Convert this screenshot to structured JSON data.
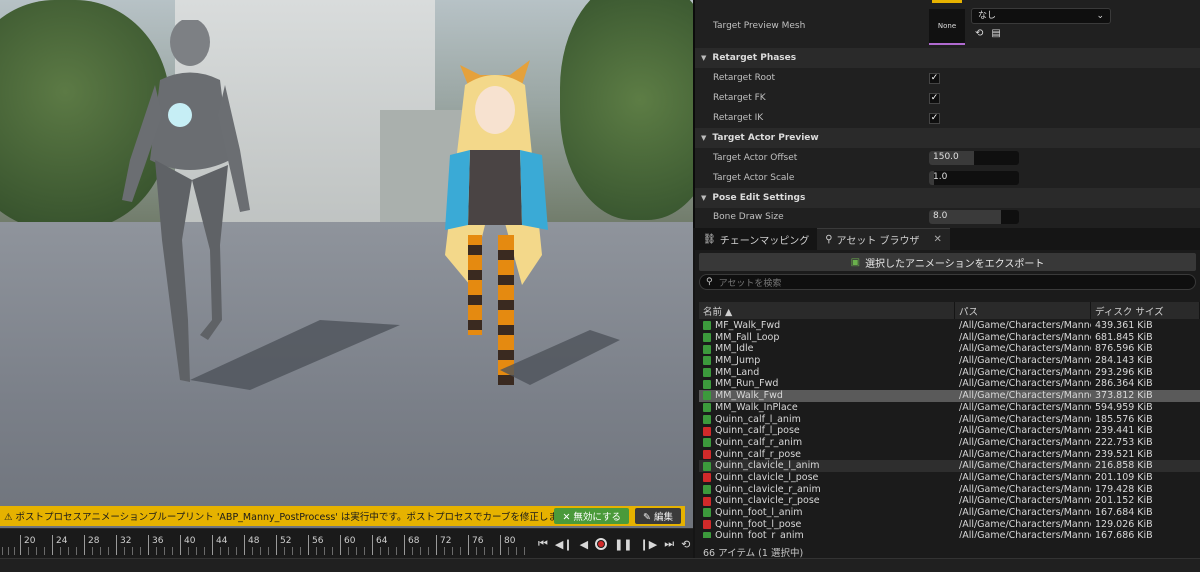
{
  "viewport": {
    "warning": {
      "message": "⚠ ポストプロセスアニメーションブループリント 'ABP_Manny_PostProcess' は実行中です。ポストプロセスでカーブを修正します。",
      "disable_label": "✕ 無効にする",
      "edit_label": "✎ 編集"
    }
  },
  "timeline": {
    "ticks": [
      "20",
      "24",
      "28",
      "32",
      "36",
      "40",
      "44",
      "48",
      "52",
      "56",
      "60",
      "64",
      "68",
      "72",
      "76",
      "80"
    ]
  },
  "details": {
    "target_preview_mesh": {
      "label": "Target Preview Mesh",
      "thumb": "None",
      "value": "なし"
    },
    "sections": {
      "retarget_phases": "Retarget Phases",
      "target_actor_preview": "Target Actor Preview",
      "pose_edit_settings": "Pose Edit Settings"
    },
    "retarget_root": {
      "label": "Retarget Root",
      "checked": true
    },
    "retarget_fk": {
      "label": "Retarget FK",
      "checked": true
    },
    "retarget_ik": {
      "label": "Retarget IK",
      "checked": true
    },
    "target_actor_offset": {
      "label": "Target Actor Offset",
      "value": "150.0",
      "fill": 0.5
    },
    "target_actor_scale": {
      "label": "Target Actor Scale",
      "value": "1.0",
      "fill": 0.05
    },
    "bone_draw_size": {
      "label": "Bone Draw Size",
      "value": "8.0",
      "fill": 0.8
    }
  },
  "tabs": {
    "chain_mapping": "チェーンマッピング",
    "asset_browser": "アセット ブラウザ"
  },
  "asset_browser": {
    "export_label": "選択したアニメーションをエクスポート",
    "search_placeholder": "アセットを検索",
    "columns": {
      "name": "名前 ▲",
      "path": "パス",
      "size": "ディスク サイズ"
    },
    "rows": [
      {
        "name": "MF_Walk_Fwd",
        "path": "/All/Game/Characters/Mannec",
        "size": "439.361 KiB",
        "icon": "green"
      },
      {
        "name": "MM_Fall_Loop",
        "path": "/All/Game/Characters/Mannec",
        "size": "681.845 KiB",
        "icon": "green"
      },
      {
        "name": "MM_Idle",
        "path": "/All/Game/Characters/Mannec",
        "size": "876.596 KiB",
        "icon": "green"
      },
      {
        "name": "MM_Jump",
        "path": "/All/Game/Characters/Mannec",
        "size": "284.143 KiB",
        "icon": "green"
      },
      {
        "name": "MM_Land",
        "path": "/All/Game/Characters/Mannec",
        "size": "293.296 KiB",
        "icon": "green"
      },
      {
        "name": "MM_Run_Fwd",
        "path": "/All/Game/Characters/Mannec",
        "size": "286.364 KiB",
        "icon": "green"
      },
      {
        "name": "MM_Walk_Fwd",
        "path": "/All/Game/Characters/Mannec",
        "size": "373.812 KiB",
        "icon": "green",
        "selected": true
      },
      {
        "name": "MM_Walk_InPlace",
        "path": "/All/Game/Characters/Mannec",
        "size": "594.959 KiB",
        "icon": "green"
      },
      {
        "name": "Quinn_calf_l_anim",
        "path": "/All/Game/Characters/Mannec",
        "size": "185.576 KiB",
        "icon": "green"
      },
      {
        "name": "Quinn_calf_l_pose",
        "path": "/All/Game/Characters/Mannec",
        "size": "239.441 KiB",
        "icon": "red"
      },
      {
        "name": "Quinn_calf_r_anim",
        "path": "/All/Game/Characters/Mannec",
        "size": "222.753 KiB",
        "icon": "green"
      },
      {
        "name": "Quinn_calf_r_pose",
        "path": "/All/Game/Characters/Mannec",
        "size": "239.521 KiB",
        "icon": "red"
      },
      {
        "name": "Quinn_clavicle_l_anim",
        "path": "/All/Game/Characters/Mannec",
        "size": "216.858 KiB",
        "icon": "green",
        "highlight": true
      },
      {
        "name": "Quinn_clavicle_l_pose",
        "path": "/All/Game/Characters/Mannec",
        "size": "201.109 KiB",
        "icon": "red"
      },
      {
        "name": "Quinn_clavicle_r_anim",
        "path": "/All/Game/Characters/Mannec",
        "size": "179.428 KiB",
        "icon": "green"
      },
      {
        "name": "Quinn_clavicle_r_pose",
        "path": "/All/Game/Characters/Mannec",
        "size": "201.152 KiB",
        "icon": "red"
      },
      {
        "name": "Quinn_foot_l_anim",
        "path": "/All/Game/Characters/Mannec",
        "size": "167.684 KiB",
        "icon": "green"
      },
      {
        "name": "Quinn_foot_l_pose",
        "path": "/All/Game/Characters/Mannec",
        "size": "129.026 KiB",
        "icon": "red"
      },
      {
        "name": "Quinn_foot_r_anim",
        "path": "/All/Game/Characters/Mannec",
        "size": "167.686 KiB",
        "icon": "green"
      }
    ],
    "status": "66 アイテム (1 選択中)"
  }
}
